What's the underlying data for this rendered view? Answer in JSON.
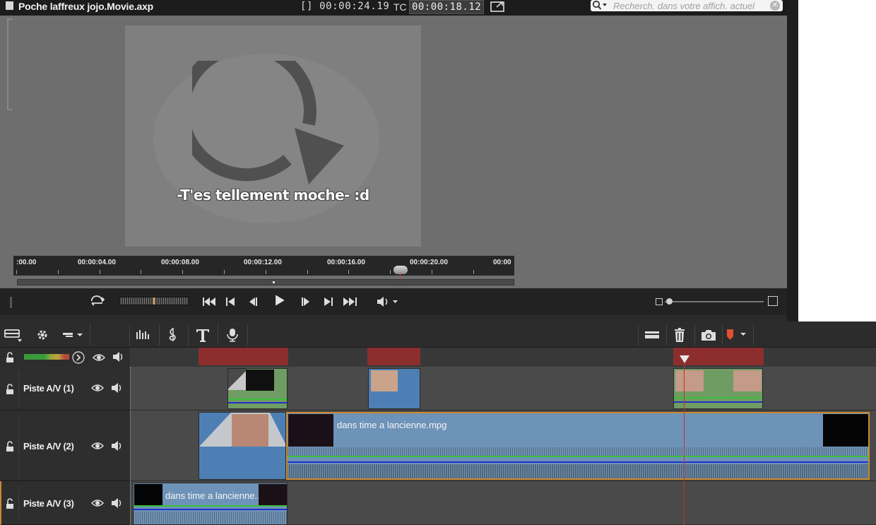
{
  "window": {
    "title": "Poche laffreux jojo.Movie.axp",
    "duration": "[] 00:00:24.19",
    "tc_label": "TC",
    "timecode": "00:00:18.12"
  },
  "search": {
    "placeholder": "Recherch. dans votre affich. actuel"
  },
  "preview": {
    "subtitle": "-T'es tellement moche- :d"
  },
  "ruler": {
    "labels": [
      ":00.00",
      "00:00:04.00",
      "00:00:08.00",
      "00:00:12.00",
      "00:00:16.00",
      "00:00:20.00",
      "00:00"
    ]
  },
  "tracks": [
    {
      "name": "Piste A/V (1)"
    },
    {
      "name": "Piste A/V (2)",
      "clip_name": "dans time a lancienne.mpg"
    },
    {
      "name": "Piste A/V (3)",
      "clip_name": "dans time a lancienne..."
    }
  ],
  "colors": {
    "marker": "#8c2e2e",
    "clip_green": "#6f9c62",
    "clip_blue": "#4d7fb5",
    "playhead": "#c83030",
    "selection_border": "#c88a30"
  },
  "icons": {
    "toolbar": [
      "storyboard-icon",
      "settings-gear-icon",
      "dropdown-icon",
      "audio-mixer-icon",
      "music-icon",
      "title-icon",
      "voiceover-mic-icon",
      "storage-icon",
      "trash-icon",
      "snapshot-icon",
      "marker-icon"
    ]
  }
}
